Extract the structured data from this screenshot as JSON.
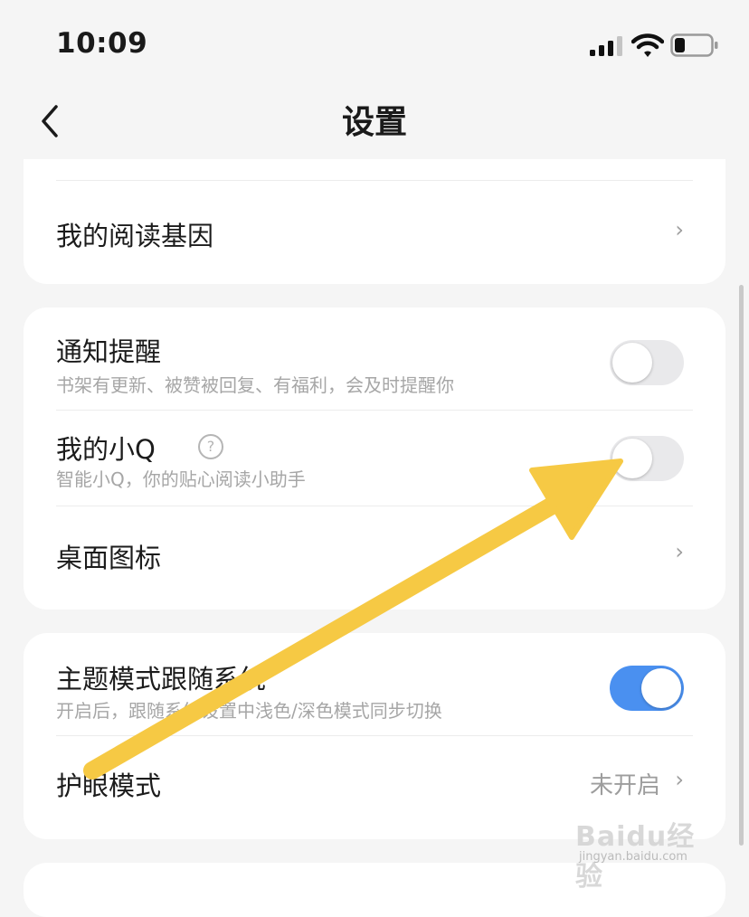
{
  "status": {
    "time": "10:09"
  },
  "nav": {
    "title": "设置"
  },
  "top_card": {
    "reading_gene": "我的阅读基因"
  },
  "group_a": {
    "notify": {
      "title": "通知提醒",
      "subtitle": "书架有更新、被赞被回复、有福利，会及时提醒你",
      "enabled": false
    },
    "xiaoq": {
      "title": "我的小Q",
      "subtitle": "智能小Q，你的贴心阅读小助手",
      "enabled": false,
      "help_glyph": "?"
    },
    "desktop_icon": {
      "title": "桌面图标"
    }
  },
  "group_b": {
    "theme_follow": {
      "title": "主题模式跟随系统",
      "subtitle": "开启后，跟随系统设置中浅色/深色模式同步切换",
      "enabled": true
    },
    "eye_mode": {
      "title": "护眼模式",
      "value": "未开启"
    }
  },
  "chevron": "›",
  "watermark": {
    "brand": "Baidu经验",
    "url": "jingyan.baidu.com"
  },
  "colors": {
    "arrow": "#f6c944",
    "toggle_on": "#4a90f0",
    "background": "#f5f5f5"
  },
  "icons": [
    "signal-bars-icon",
    "wifi-icon",
    "battery-icon",
    "back-chevron-icon",
    "help-circle-icon",
    "chevron-right-icon",
    "annotation-arrow"
  ]
}
